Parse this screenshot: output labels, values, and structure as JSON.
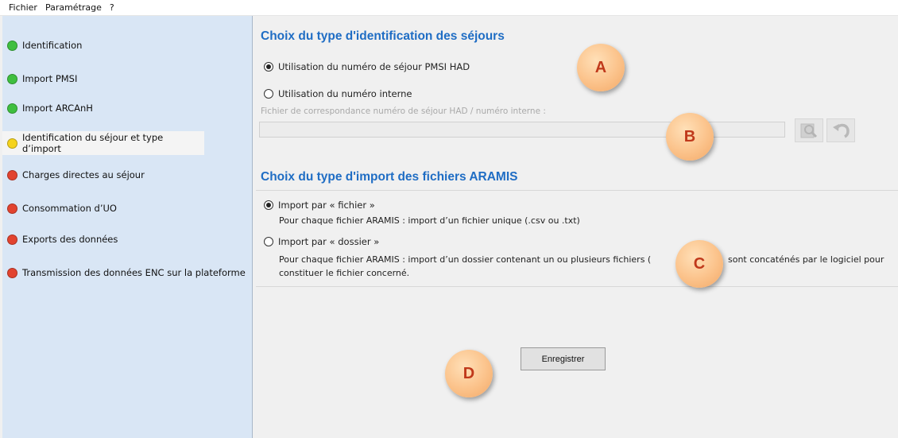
{
  "menu": {
    "items": [
      "Fichier",
      "Paramétrage",
      "?"
    ]
  },
  "sidebar": {
    "items": [
      {
        "label": "Identification",
        "status": "green"
      },
      {
        "label": "Import PMSI",
        "status": "green"
      },
      {
        "label": "Import ARCAnH",
        "status": "green"
      },
      {
        "label": "Identification du séjour et type d’import",
        "status": "yellow",
        "selected": true
      },
      {
        "label": "Charges directes au séjour",
        "status": "red"
      },
      {
        "label": "Consommation d’UO",
        "status": "red"
      },
      {
        "label": "Exports des données",
        "status": "red"
      },
      {
        "label": "Transmission des données ENC sur la plateforme",
        "status": "red"
      }
    ]
  },
  "colors": {
    "green": "#3fbf3f",
    "yellow": "#f5d31c",
    "red": "#e2432f",
    "title_blue": "#1f6dc4"
  },
  "identification": {
    "title": "Choix du type d'identification des séjours",
    "option_pmsi": "Utilisation du numéro de séjour PMSI HAD",
    "option_pmsi_selected": true,
    "option_internal": "Utilisation du numéro interne",
    "option_internal_selected": false,
    "file_label": "Fichier de correspondance numéro de séjour HAD / numéro interne :",
    "file_value": "",
    "browse_icon": "search-file-icon",
    "undo_icon": "undo-icon"
  },
  "import_type": {
    "title": "Choix du type d'import des fichiers ARAMIS",
    "option_file": "Import par « fichier »",
    "option_file_selected": true,
    "option_file_desc": "Pour chaque fichier ARAMIS : import d’un fichier unique (.csv ou .txt)",
    "option_folder": "Import par « dossier »",
    "option_folder_selected": false,
    "option_folder_desc_1a": "Pour chaque fichier ARAMIS : import d’un dossier contenant un ou plusieurs fichiers (",
    "option_folder_desc_1b": "sont concaténés par le logiciel pour",
    "option_folder_desc_2": "constituer le fichier concerné."
  },
  "save_button": "Enregistrer",
  "callouts": [
    "A",
    "B",
    "C",
    "D"
  ]
}
